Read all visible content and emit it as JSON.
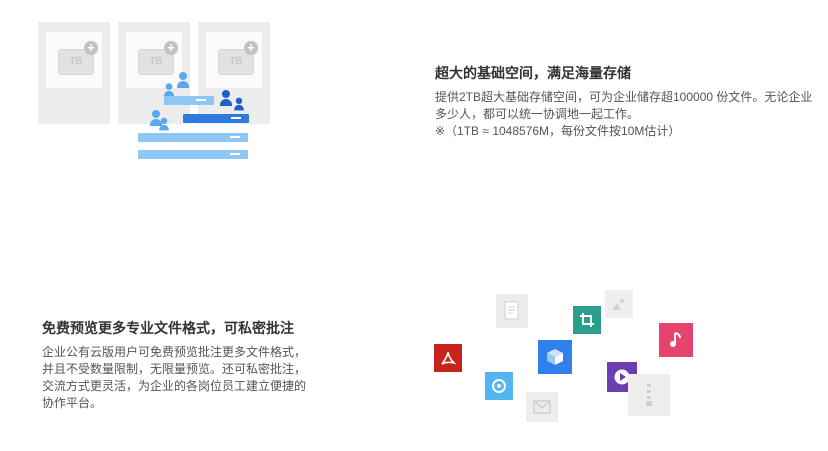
{
  "storage": {
    "disk_label": "TB",
    "title": "超大的基础空间，满足海量存储",
    "lines": [
      "提供2TB超大基础存储空间，可为企业储存超100000 份文件。无论企业",
      "多少人，都可以统一协调地一起工作。",
      "※（1TB ≈ 1048576M，每份文件按10M估计）"
    ]
  },
  "preview": {
    "title": "免费预览更多专业文件格式，可私密批注",
    "lines": [
      "企业公有云版用户可免费预览批注更多文件格式，",
      "并且不受数量限制，无限量预览。还可私密批注，",
      "交流方式更灵活，为企业的各岗位员工建立便捷的",
      "协作平台。"
    ]
  },
  "colors": {
    "pdf": "#c9241c",
    "crop": "#2a9d8f",
    "box": "#2f80ed",
    "music": "#e8436e",
    "camera": "#52b4f0",
    "video": "#6b3fb0",
    "gray_tile": "#e9e9e9"
  },
  "icons": [
    "document-icon",
    "image-icon",
    "crop-icon",
    "pdf-icon",
    "cube-icon",
    "music-icon",
    "camera-icon",
    "play-icon",
    "zip-icon",
    "mail-icon"
  ]
}
